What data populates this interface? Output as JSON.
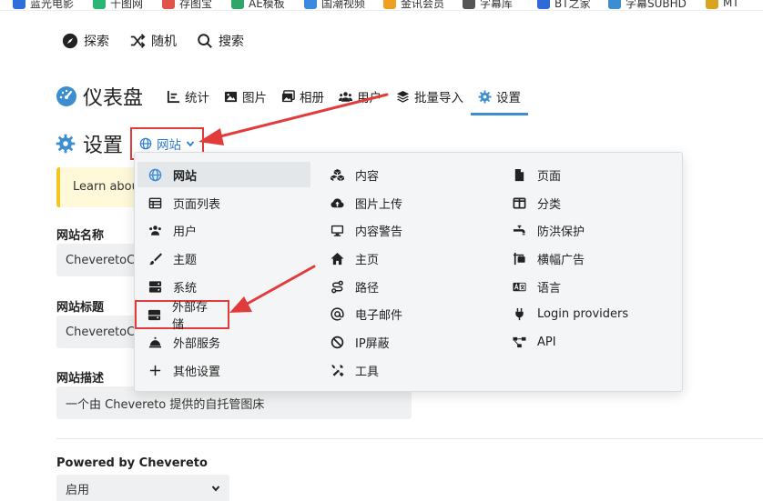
{
  "bookmarks": [
    {
      "label": "蓝光电影",
      "color": "#2d6fd8"
    },
    {
      "label": "千图网",
      "color": "#2bb673"
    },
    {
      "label": "存图宝",
      "color": "#e0534a"
    },
    {
      "label": "AE模板",
      "color": "#2ea66a"
    },
    {
      "label": "国潮视频",
      "color": "#3a8be0"
    },
    {
      "label": "金讯会员",
      "color": "#f0a020"
    },
    {
      "label": "字幕库",
      "color": "#555555"
    },
    {
      "label": "BT之家",
      "color": "#2f6bd8"
    },
    {
      "label": "字幕SUBHD",
      "color": "#3d8ed0"
    },
    {
      "label": "MT",
      "color": "#d9a520"
    }
  ],
  "topnav": {
    "explore": "探索",
    "random": "随机",
    "search": "搜索"
  },
  "dashboard": {
    "title": "仪表盘",
    "tabs": [
      {
        "label": "统计"
      },
      {
        "label": "图片"
      },
      {
        "label": "相册"
      },
      {
        "label": "用户"
      },
      {
        "label": "批量导入"
      },
      {
        "label": "设置"
      }
    ]
  },
  "settings": {
    "title": "设置",
    "section_dropdown": "网站",
    "notice": "Learn about the settings",
    "fields": {
      "site_name_label": "网站名称",
      "site_name_value": "CheveretoCMS",
      "site_title_label": "网站标题",
      "site_title_value": "CheveretoCMS",
      "site_desc_label": "网站描述",
      "site_desc_value": "一个由 Chevereto 提供的自托管图床",
      "powered_label": "Powered by Chevereto",
      "powered_value": "启用"
    }
  },
  "menu": {
    "col1": [
      "网站",
      "页面列表",
      "用户",
      "主题",
      "系统",
      "外部存储",
      "外部服务",
      "其他设置"
    ],
    "col2": [
      "内容",
      "图片上传",
      "内容警告",
      "主页",
      "路径",
      "电子邮件",
      "IP屏蔽",
      "工具"
    ],
    "col3": [
      "页面",
      "分类",
      "防洪保护",
      "横幅广告",
      "语言",
      "Login providers",
      "API"
    ]
  },
  "colors": {
    "accent": "#3d8ed0",
    "highlight_box": "#e23b3b",
    "notice_bg": "#fff8d9",
    "notice_bar": "#f3c623"
  }
}
